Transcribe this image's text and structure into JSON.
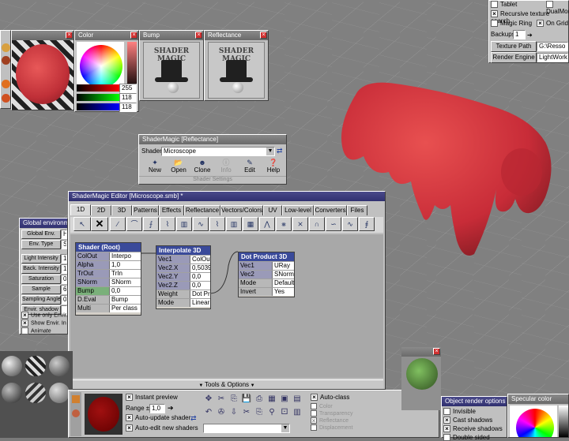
{
  "colors": {
    "title_active": "#303070",
    "accent_red": "#d43040",
    "node_header": "#3a4a9a"
  },
  "color_window": {
    "title": "Color",
    "r": "255",
    "g": "118",
    "b": "118"
  },
  "bump_window": {
    "title": "Bump",
    "logo": "SHADER MAGIC"
  },
  "reflectance_window": {
    "title": "Reflectance",
    "logo": "SHADER MAGIC"
  },
  "top_right": {
    "tablet": "Tablet",
    "dualmon": "DualMoni",
    "recursive_texture_search": "Recursive texture search",
    "magic_ring": "Magic Ring",
    "on_grid": "On Grid",
    "backups_label": "Backups",
    "backups_value": "1",
    "texture_path_button": "Texture Path",
    "texture_path_value": "G:\\Resso",
    "render_engine_button": "Render Engine",
    "render_engine_value": "LightWorks"
  },
  "reflectance_dialog": {
    "title": "ShaderMagic [Reflectance]",
    "shader_label": "Shader",
    "shader_value": "Microscope",
    "buttons": [
      "New",
      "Open",
      "Clone",
      "Info",
      "Edit",
      "Help"
    ],
    "footer": "Shader Settings"
  },
  "global_env": {
    "title": "Global environm...",
    "rows": [
      {
        "label": "Global Env.",
        "value": "Hi"
      },
      {
        "label": "Env. Type",
        "value": "S"
      },
      {
        "label": "Light Intensity",
        "value": "1"
      },
      {
        "label": "Back. Intensity",
        "value": "1"
      },
      {
        "label": "Saturation",
        "value": "0"
      },
      {
        "label": "Sample",
        "value": "6"
      },
      {
        "label": "Sampling Angle",
        "value": "0"
      },
      {
        "label": "Envir. shadow",
        "value": ""
      }
    ],
    "checks": [
      {
        "label": "Use only Envir.",
        "checked": true
      },
      {
        "label": "Show Envir. In",
        "checked": true
      },
      {
        "label": "Animate",
        "checked": false
      }
    ]
  },
  "editor": {
    "title": "ShaderMagic Editor [Microscope.smb] *",
    "tabs": [
      "1D",
      "2D",
      "3D",
      "Patterns",
      "Effects",
      "Reflectance",
      "Vectors/Colors",
      "UV",
      "Low-level",
      "Converters",
      "Files"
    ],
    "selected_tab": "1D",
    "tools_label": "Tools & Options",
    "nodes": {
      "root": {
        "title": "Shader (Root)",
        "rows": [
          {
            "k": "ColOut",
            "v": "Interpo"
          },
          {
            "k": "Alpha",
            "v": "1,0"
          },
          {
            "k": "TrOut",
            "v": "TrIn"
          },
          {
            "k": "SNorm",
            "v": "SNorm"
          },
          {
            "k": "Bump",
            "v": "0,0"
          },
          {
            "k": "D.Eval",
            "v": "Bump"
          },
          {
            "k": "Multi",
            "v": "Per class"
          }
        ]
      },
      "interp": {
        "title": "Interpolate 3D",
        "rows": [
          {
            "k": "Vec1",
            "v": "ColOut"
          },
          {
            "k": "Vec2.X",
            "v": "0,5039"
          },
          {
            "k": "Vec2.Y",
            "v": "0,0"
          },
          {
            "k": "Vec2.Z",
            "v": "0,0"
          },
          {
            "k": "Weight",
            "v": "Dot Pro"
          },
          {
            "k": "Mode",
            "v": "Linear"
          }
        ]
      },
      "dot": {
        "title": "Dot Product 3D",
        "rows": [
          {
            "k": "Vec1",
            "v": "URay"
          },
          {
            "k": "Vec2",
            "v": "SNorm"
          },
          {
            "k": "Mode",
            "v": "Default"
          },
          {
            "k": "Invert",
            "v": "Yes"
          }
        ]
      }
    }
  },
  "bottom": {
    "instant_preview": "Instant preview",
    "range_label": "Range ±",
    "range_value": "1,0",
    "auto_update": "Auto-update shader",
    "auto_edit": "Auto-edit new shaders",
    "auto_class": "Auto-class",
    "class_items": [
      "Color",
      "Transparency",
      "Reflectance",
      "Displacement"
    ]
  },
  "object_render": {
    "title": "Object render options",
    "items": [
      {
        "label": "Invisible",
        "checked": false
      },
      {
        "label": "Cast shadows",
        "checked": true
      },
      {
        "label": "Receive shadows",
        "checked": true
      },
      {
        "label": "Double sided",
        "checked": false
      }
    ]
  },
  "specular": {
    "title": "Specular color"
  }
}
